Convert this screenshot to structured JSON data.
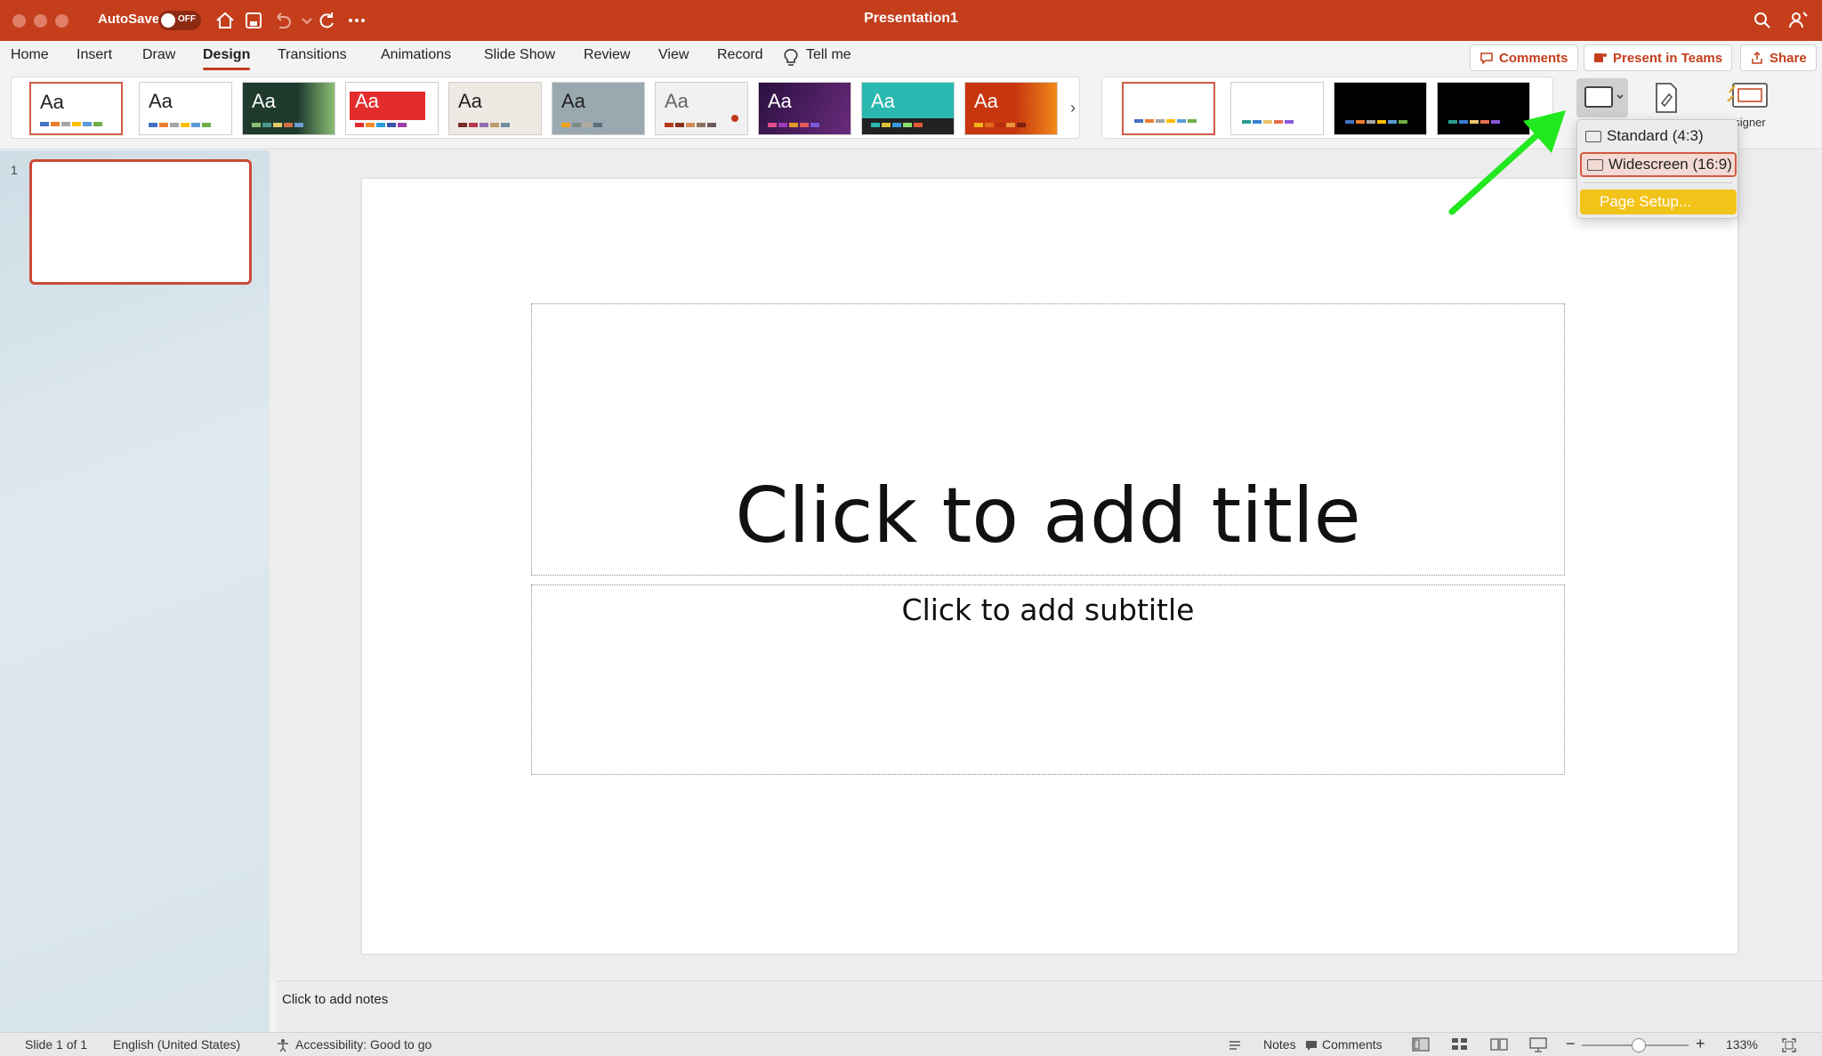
{
  "window": {
    "title": "Presentation1",
    "autosave_label": "AutoSave",
    "autosave_state": "OFF"
  },
  "tabs": [
    {
      "label": "Home"
    },
    {
      "label": "Insert"
    },
    {
      "label": "Draw"
    },
    {
      "label": "Design",
      "active": true
    },
    {
      "label": "Transitions"
    },
    {
      "label": "Animations"
    },
    {
      "label": "Slide Show"
    },
    {
      "label": "Review"
    },
    {
      "label": "View"
    },
    {
      "label": "Record"
    },
    {
      "label": "Tell me"
    }
  ],
  "top_buttons": {
    "comments": "Comments",
    "present_in_teams": "Present in Teams",
    "share": "Share"
  },
  "ribbon": {
    "themes": [
      {
        "aa": "Aa",
        "bg": "#ffffff",
        "fg": "#222222",
        "selected": true
      },
      {
        "aa": "Aa",
        "bg": "#ffffff",
        "fg": "#222222"
      },
      {
        "aa": "Aa",
        "bg": "#1f3b2e",
        "fg": "#ffffff"
      },
      {
        "aa": "Aa",
        "bg": "#e32d2d",
        "fg": "#ffffff"
      },
      {
        "aa": "Aa",
        "bg": "#efe9e4",
        "fg": "#222222"
      },
      {
        "aa": "Aa",
        "bg": "#9aa9b0",
        "fg": "#222222"
      },
      {
        "aa": "Aa",
        "bg": "#f1f1f1",
        "fg": "#666666"
      },
      {
        "aa": "Aa",
        "bg": "#3b1a56",
        "fg": "#ffffff"
      },
      {
        "aa": "Aa",
        "bg": "#2ab8b0",
        "fg": "#ffffff"
      },
      {
        "aa": "Aa",
        "bg": "#c8360f",
        "fg": "#ffffff"
      }
    ],
    "variants": [
      {
        "bg": "#ffffff",
        "selected": true
      },
      {
        "bg": "#ffffff"
      },
      {
        "bg": "#000000"
      },
      {
        "bg": "#000000"
      }
    ],
    "designer_label": "Designer"
  },
  "thumbnails": {
    "slide_number": "1"
  },
  "slide": {
    "title_placeholder": "Click to add title",
    "subtitle_placeholder": "Click to add subtitle"
  },
  "notes": {
    "placeholder": "Click to add notes"
  },
  "dropdown": {
    "items": [
      {
        "label": "Standard (4:3)"
      },
      {
        "label": "Widescreen (16:9)",
        "selected": true
      },
      {
        "label": "Page Setup...",
        "highlight": true
      }
    ]
  },
  "statusbar": {
    "slide_info": "Slide 1 of 1",
    "language": "English (United States)",
    "accessibility": "Accessibility: Good to go",
    "notes": "Notes",
    "comments": "Comments",
    "zoom": "133%"
  },
  "colors": {
    "accent": "#c43e1c",
    "annotation_arrow": "#22e81f",
    "dropdown_highlight": "#f2c318"
  },
  "icons": [
    "home-icon",
    "save-icon",
    "undo-icon",
    "redo-icon",
    "more-icon",
    "search-icon",
    "share-person-icon",
    "lightbulb-icon",
    "comment-icon",
    "teams-icon",
    "slide-size-icon",
    "format-background-icon",
    "designer-icon"
  ]
}
